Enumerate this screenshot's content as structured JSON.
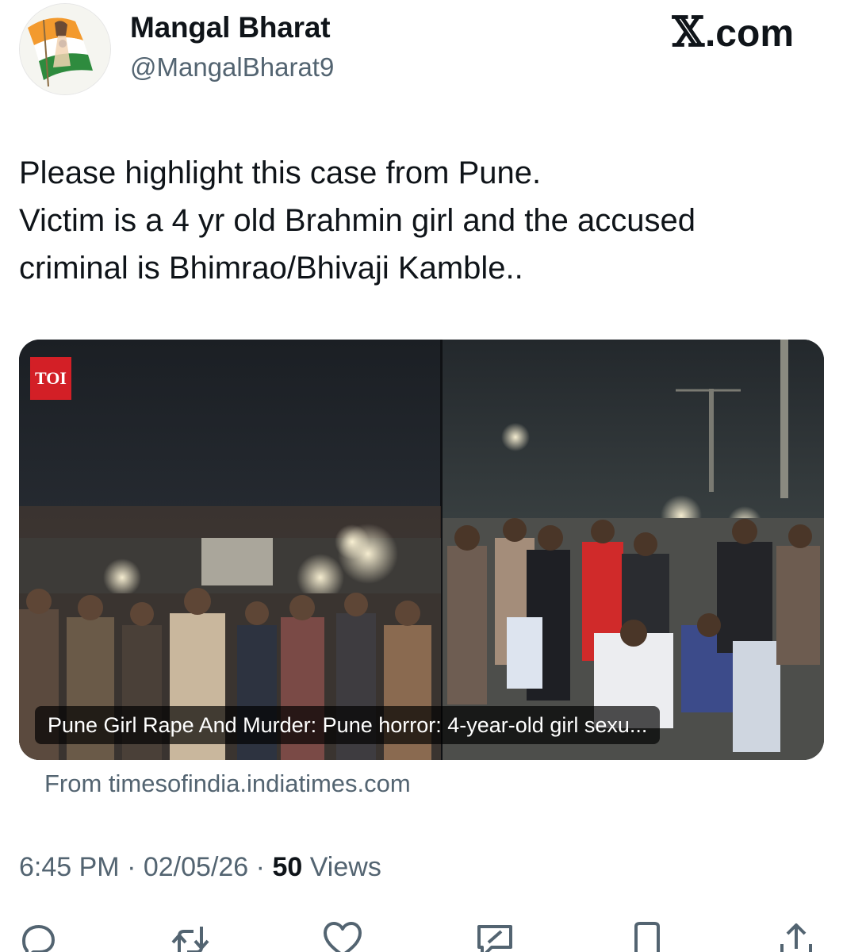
{
  "author": {
    "display_name": "Mangal Bharat",
    "handle": "@MangalBharat9"
  },
  "brand": {
    "symbol": "𝕏",
    "suffix": ".com"
  },
  "tweet": {
    "lines": [
      "Please highlight this case from Pune.",
      "Victim is a 4 yr old Brahmin girl and the accused",
      "criminal is Bhimrao/Bhivaji Kamble.."
    ]
  },
  "card": {
    "badge": "TOI",
    "caption": "Pune Girl Rape And Murder: Pune horror: 4-year-old girl sexu...",
    "source": "From timesofindia.indiatimes.com"
  },
  "meta": {
    "time": "6:45 PM",
    "separator": "·",
    "date": "02/05/26",
    "views_count": "50",
    "views_label": "Views"
  },
  "actions": {
    "icons": [
      "reply-icon",
      "repost-icon",
      "like-icon",
      "grok-icon",
      "bookmark-icon",
      "share-icon"
    ]
  },
  "colors": {
    "text_primary": "#0f1419",
    "text_secondary": "#536471",
    "toi_red": "#d31f26"
  }
}
